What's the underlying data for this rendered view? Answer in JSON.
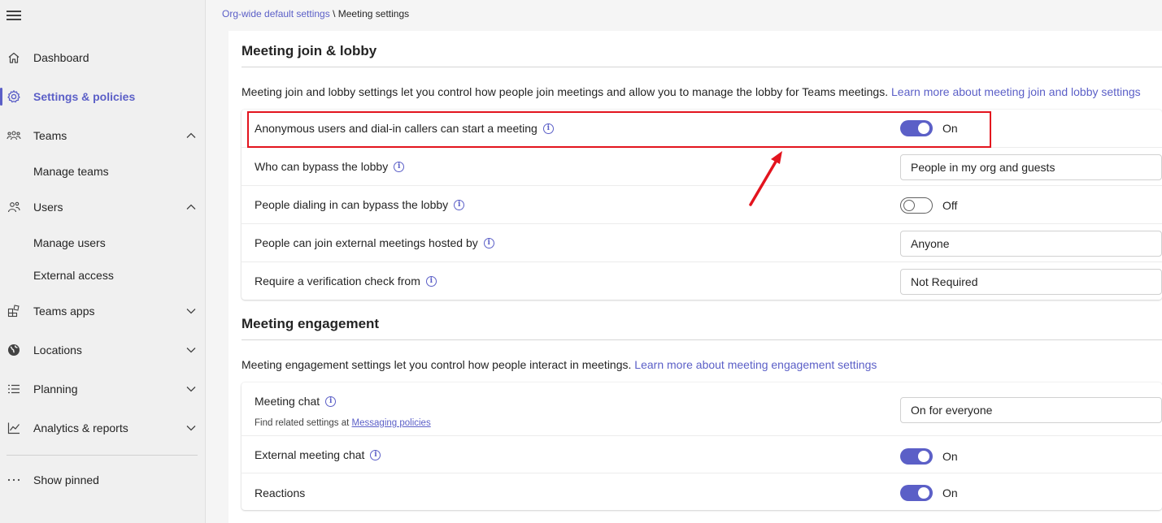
{
  "sidebar": {
    "items": [
      {
        "label": "Dashboard",
        "icon": "home-icon"
      },
      {
        "label": "Settings & policies",
        "icon": "gear-icon"
      },
      {
        "label": "Teams",
        "icon": "teams-icon"
      },
      {
        "label": "Manage teams"
      },
      {
        "label": "Users",
        "icon": "users-icon"
      },
      {
        "label": "Manage users"
      },
      {
        "label": "External access"
      },
      {
        "label": "Teams apps",
        "icon": "apps-icon"
      },
      {
        "label": "Locations",
        "icon": "globe-icon"
      },
      {
        "label": "Planning",
        "icon": "planning-icon"
      },
      {
        "label": "Analytics & reports",
        "icon": "chart-icon"
      },
      {
        "label": "Show pinned",
        "icon": "more-icon"
      }
    ]
  },
  "breadcrumb": {
    "parent": "Org-wide default settings",
    "separator": " \\ ",
    "current": "Meeting settings"
  },
  "join_lobby": {
    "title": "Meeting join & lobby",
    "description": "Meeting join and lobby settings let you control how people join meetings and allow you to manage the lobby for Teams meetings.",
    "link": "Learn more about meeting join and lobby settings",
    "rows": [
      {
        "label": "Anonymous users and dial-in callers can start a meeting",
        "toggle": "On"
      },
      {
        "label": "Who can bypass the lobby",
        "value": "People in my org and guests"
      },
      {
        "label": "People dialing in can bypass the lobby",
        "toggle": "Off"
      },
      {
        "label": "People can join external meetings hosted by",
        "value": "Anyone"
      },
      {
        "label": "Require a verification check from",
        "value": "Not Required"
      }
    ]
  },
  "engagement": {
    "title": "Meeting engagement",
    "description": "Meeting engagement settings let you control how people interact in meetings.",
    "link": "Learn more about meeting engagement settings",
    "rows": [
      {
        "label": "Meeting chat",
        "subtext": "Find related settings at ",
        "sublink": "Messaging policies",
        "value": "On for everyone"
      },
      {
        "label": "External meeting chat",
        "toggle": "On"
      },
      {
        "label": "Reactions",
        "toggle": "On"
      }
    ]
  },
  "colors": {
    "accent": "#5b5fc7",
    "highlight": "#e3141e"
  }
}
